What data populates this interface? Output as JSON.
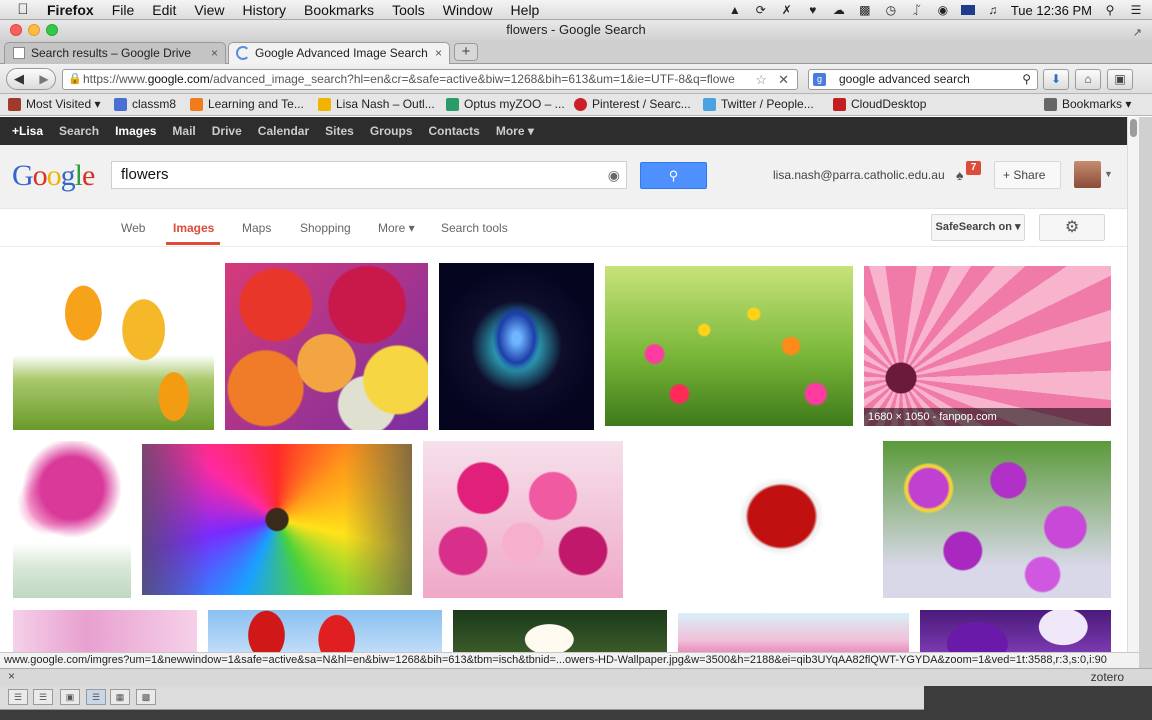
{
  "menubar": {
    "app": "Firefox",
    "items": [
      "File",
      "Edit",
      "View",
      "History",
      "Bookmarks",
      "Tools",
      "Window",
      "Help"
    ],
    "clock": "Tue 12:36 PM"
  },
  "window": {
    "title": "flowers - Google Search"
  },
  "tabs": [
    {
      "label": "Search results – Google Drive",
      "close": "×"
    },
    {
      "label": "Google Advanced Image Search",
      "close": "×"
    }
  ],
  "newtab_label": "+",
  "nav": {
    "url_prefix": "https://www.",
    "url_host": "google.com",
    "url_rest": "/advanced_image_search?hl=en&cr=&safe=active&biw=1268&bih=613&um=1&ie=UTF-8&q=flowe",
    "search_value": "google advanced search"
  },
  "bookmarks": [
    {
      "label": "Most Visited ▾",
      "color": "#a03a2a"
    },
    {
      "label": "classm8",
      "color": "#4a6fd0"
    },
    {
      "label": "Learning and Te...",
      "color": "#f07c1e"
    },
    {
      "label": "Lisa Nash – Outl...",
      "color": "#f2b400"
    },
    {
      "label": "Optus myZOO – ...",
      "color": "#2a9c6a"
    },
    {
      "label": "Pinterest / Searc...",
      "color": "#cb2027"
    },
    {
      "label": "Twitter / People...",
      "color": "#4aa3df"
    },
    {
      "label": "CloudDesktop",
      "color": "#c02020"
    }
  ],
  "bookmarks_menu": "Bookmarks ▾",
  "gbar": [
    "+Lisa",
    "Search",
    "Images",
    "Mail",
    "Drive",
    "Calendar",
    "Sites",
    "Groups",
    "Contacts",
    "More ▾"
  ],
  "google": {
    "logo": [
      "G",
      "o",
      "o",
      "g",
      "l",
      "e"
    ],
    "query": "flowers",
    "user_email": "lisa.nash@parra.catholic.edu.au",
    "notification_count": "7",
    "share_label": "+ Share"
  },
  "subnav": {
    "items": [
      "Web",
      "Images",
      "Maps",
      "Shopping",
      "More ▾",
      "Search tools"
    ],
    "safesearch": "SafeSearch on ▾"
  },
  "results": {
    "hover_caption": "1680 × 1050 - fanpop.com"
  },
  "status_url": "www.google.com/imgres?um=1&newwindow=1&safe=active&sa=N&hl=en&biw=1268&bih=613&tbm=isch&tbnid=...owers-HD-Wallpaper.jpg&w=3500&h=2188&ei=qib3UYqAA82flQWT-YGYDA&zoom=1&ved=1t:3588,r:3,s:0,i:90",
  "addon": {
    "close": "×",
    "zotero": "zotero"
  }
}
